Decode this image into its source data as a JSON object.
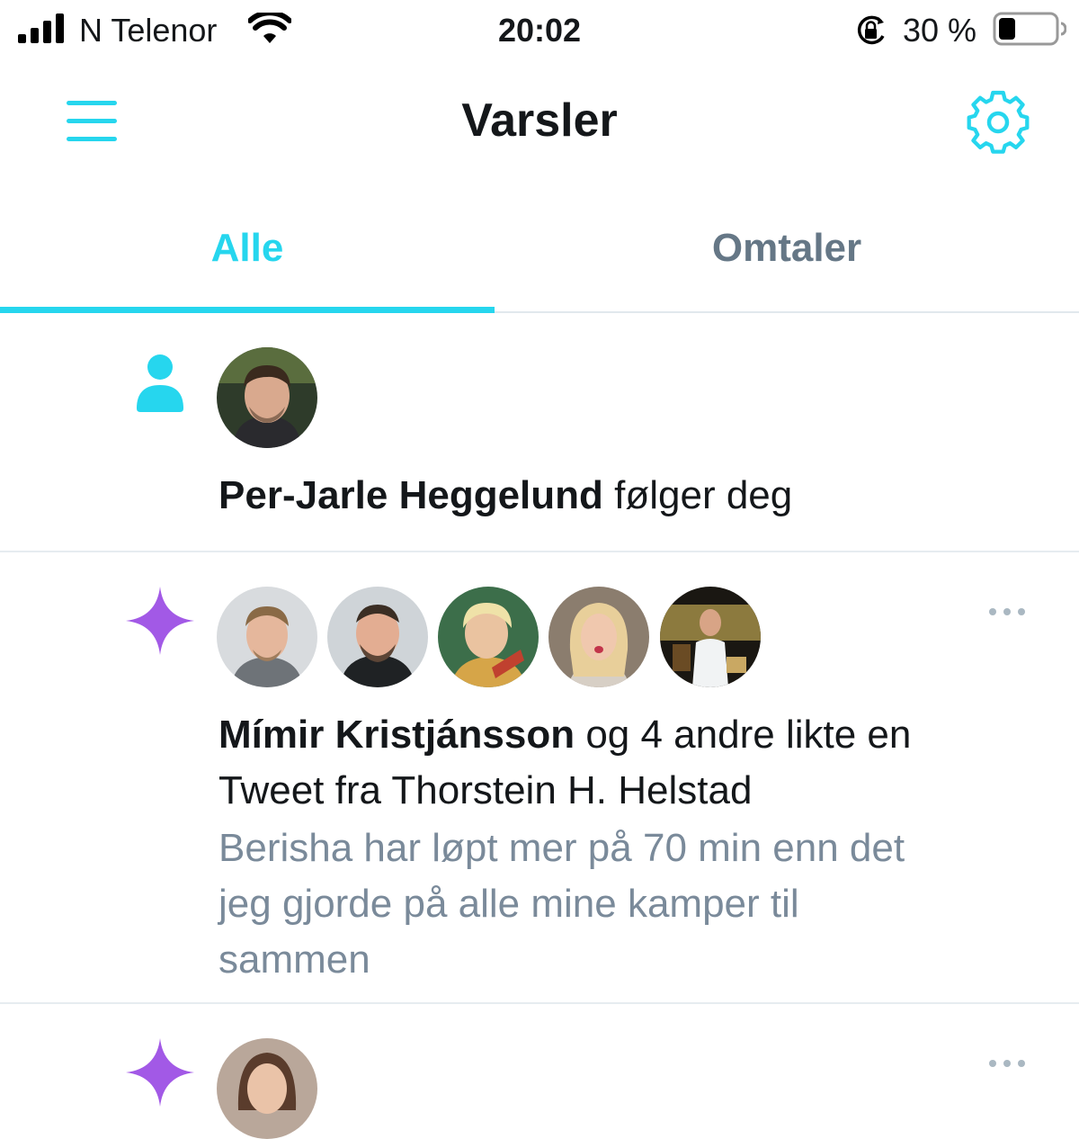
{
  "status_bar": {
    "carrier": "N Telenor",
    "time": "20:02",
    "battery_percent": "30 %",
    "battery_level": 0.3,
    "icons": [
      "signal-icon",
      "wifi-icon",
      "orientation-lock-icon",
      "battery-icon"
    ]
  },
  "header": {
    "title": "Varsler",
    "menu_icon": "hamburger-menu-icon",
    "settings_icon": "gear-icon"
  },
  "tabs": [
    {
      "label": "Alle",
      "active": true
    },
    {
      "label": "Omtaler",
      "active": false
    }
  ],
  "colors": {
    "accent": "#26d6ee",
    "like_icon": "#a259e6",
    "inactive_tab": "#657786",
    "preview_text": "#7a8a9a"
  },
  "notifications": [
    {
      "type_icon": "person-icon",
      "actor": "Per-Jarle Heggelund",
      "action": " følger deg"
    },
    {
      "type_icon": "sparkle-icon",
      "actor": "Mímir Kristjánsson",
      "action_line1": " og 4 andre likte en",
      "action_line2": "Tweet fra Thorstein H. Helstad",
      "preview": [
        "Berisha har løpt mer på 70 min enn det",
        "jeg gjorde på alle mine kamper til",
        "sammen"
      ],
      "more_icon": "more-options-icon"
    },
    {
      "type_icon": "sparkle-icon",
      "more_icon": "more-options-icon"
    }
  ]
}
